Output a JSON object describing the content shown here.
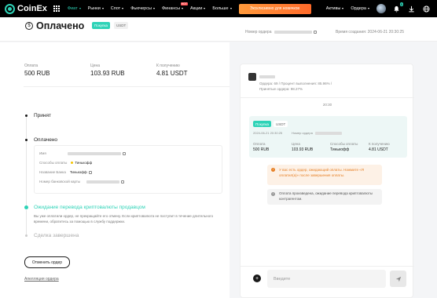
{
  "nav": {
    "logo_text": "CoinEx",
    "items": [
      "Фиат",
      "Рынки",
      "Спот",
      "Фьючерсы",
      "Финансы",
      "Акции",
      "Больше"
    ],
    "hot_label": "HOT",
    "promo": "Эксклюзивно для новичков",
    "right_items": [
      "Активы",
      "Ордера"
    ],
    "bell_count": "5"
  },
  "header": {
    "title": "Оплачено",
    "tag_buy": "Покупка",
    "tag_coin": "USDT",
    "order_label": "Номер ордера",
    "created": "Время создания: 2024-06-21 20:30:25"
  },
  "stats": [
    {
      "label": "Оплата",
      "value": "500 RUB"
    },
    {
      "label": "Цена",
      "value": "103.93 RUB"
    },
    {
      "label": "К получению",
      "value": "4.81 USDT"
    }
  ],
  "steps": {
    "accepted": "Принят",
    "paid": "Оплачено",
    "waiting": "Ожидание перевода криптовалюты продавцом",
    "completed": "Сделка завершена"
  },
  "payment": {
    "name_label": "Имя",
    "method_label": "Способы оплаты",
    "method_value": "Тинькофф",
    "bank_label": "Название Банка",
    "bank_value": "Тинькофф",
    "card_label": "Номер банковской карты"
  },
  "waiting_desc": "Вы уже оплатили ордер, не прекращайте его отмену. Если криптовалюта не поступит в течение длительного времени, обратитесь за помощью в службу поддержки.",
  "buttons": {
    "cancel": "Отменить ордер",
    "appeal": "Апелляция ордера"
  },
  "chat": {
    "peer_stats_line1": "Ордера: 69  /  Процент выполнения: 85.96%  /",
    "peer_stats_line2": "Принятые ордера: 98.27%",
    "time": "20:30",
    "card": {
      "tag_buy": "Покупка",
      "tag_coin": "USDT",
      "date": "2024-06-21 20:30:25",
      "order_label": "Номер ордера",
      "cols": [
        {
          "label": "Оплата",
          "value": "500 RUB"
        },
        {
          "label": "Цена",
          "value": "103.93 RUB"
        },
        {
          "label": "Способы оплаты",
          "value": "Тинькофф"
        },
        {
          "label": "К получению",
          "value": "4.81 USDT"
        }
      ]
    },
    "msg_orange": "У вас есть ордер, ожидающий оплаты. Нажмите «Я оплатил(а)» после завершения оплаты.",
    "msg_grey": "Оплата произведена, ожидание перевода криптовалюты контрагентом.",
    "input_placeholder": "Введите"
  },
  "colors": {
    "accent": "#2ed3b7",
    "orange": "#e67e22"
  }
}
